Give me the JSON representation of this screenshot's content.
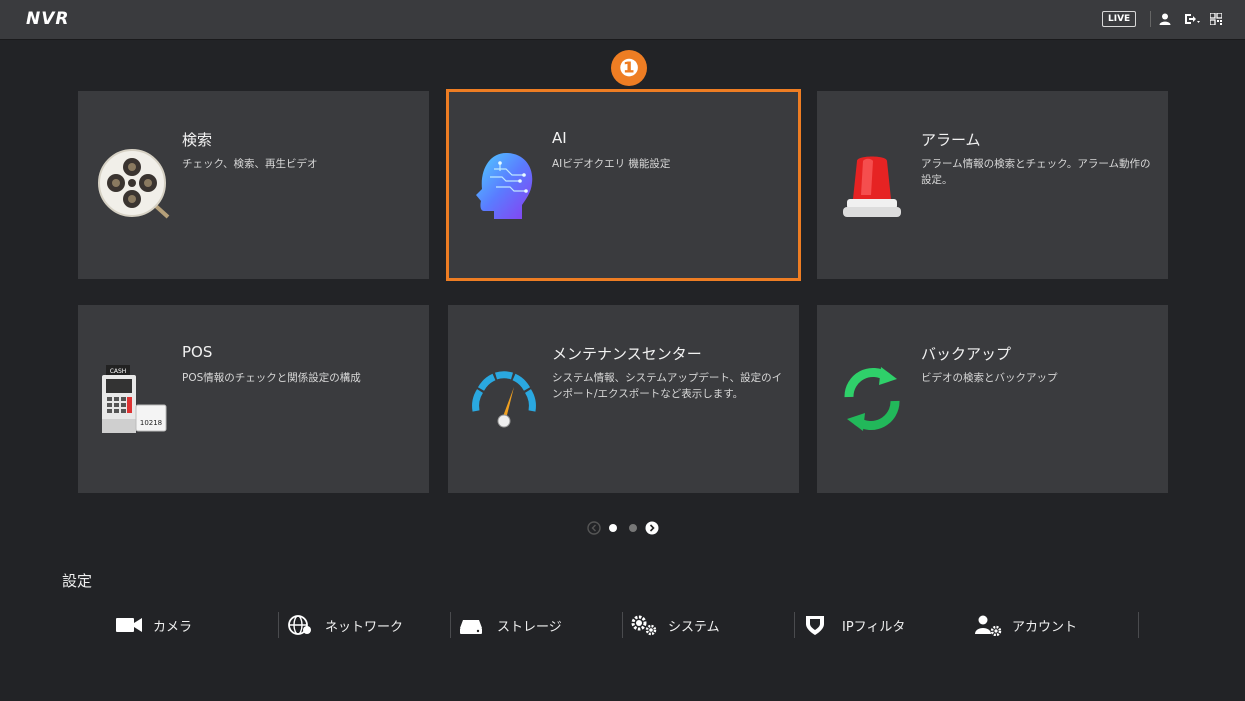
{
  "header": {
    "logo": "NVR",
    "live_label": "LIVE",
    "icons": [
      "user-icon",
      "logout-icon",
      "qr-code-icon"
    ]
  },
  "step_marker": "❶",
  "cards": [
    {
      "title": "検索",
      "desc": "チェック、検索、再生ビデオ",
      "icon": "film-reel-search-icon"
    },
    {
      "title": "AI",
      "desc": "AIビデオクエリ 機能設定",
      "icon": "ai-head-icon"
    },
    {
      "title": "アラーム",
      "desc": "アラーム情報の検索とチェック。アラーム動作の設定。",
      "icon": "alarm-light-icon"
    },
    {
      "title": "POS",
      "desc": "POS情報のチェックと関係設定の構成",
      "icon": "pos-terminal-icon"
    },
    {
      "title": "メンテナンスセンター",
      "desc": "システム情報、システムアップデート、設定のインポート/エクスポートなど表示します。",
      "icon": "gauge-icon"
    },
    {
      "title": "バックアップ",
      "desc": "ビデオの検索とバックアップ",
      "icon": "backup-arrows-icon"
    }
  ],
  "pager": {
    "current": 1,
    "total": 2
  },
  "settings": {
    "label": "設定",
    "items": [
      {
        "label": "カメラ",
        "icon": "camera-icon"
      },
      {
        "label": "ネットワーク",
        "icon": "network-globe-icon"
      },
      {
        "label": "ストレージ",
        "icon": "storage-icon"
      },
      {
        "label": "システム",
        "icon": "gears-icon"
      },
      {
        "label": "IPフィルタ",
        "icon": "shield-icon"
      },
      {
        "label": "アカウント",
        "icon": "account-gear-icon"
      }
    ]
  },
  "colors": {
    "highlight": "#ee7d23",
    "card_bg": "#3a3b3e",
    "page_bg": "#222326"
  }
}
